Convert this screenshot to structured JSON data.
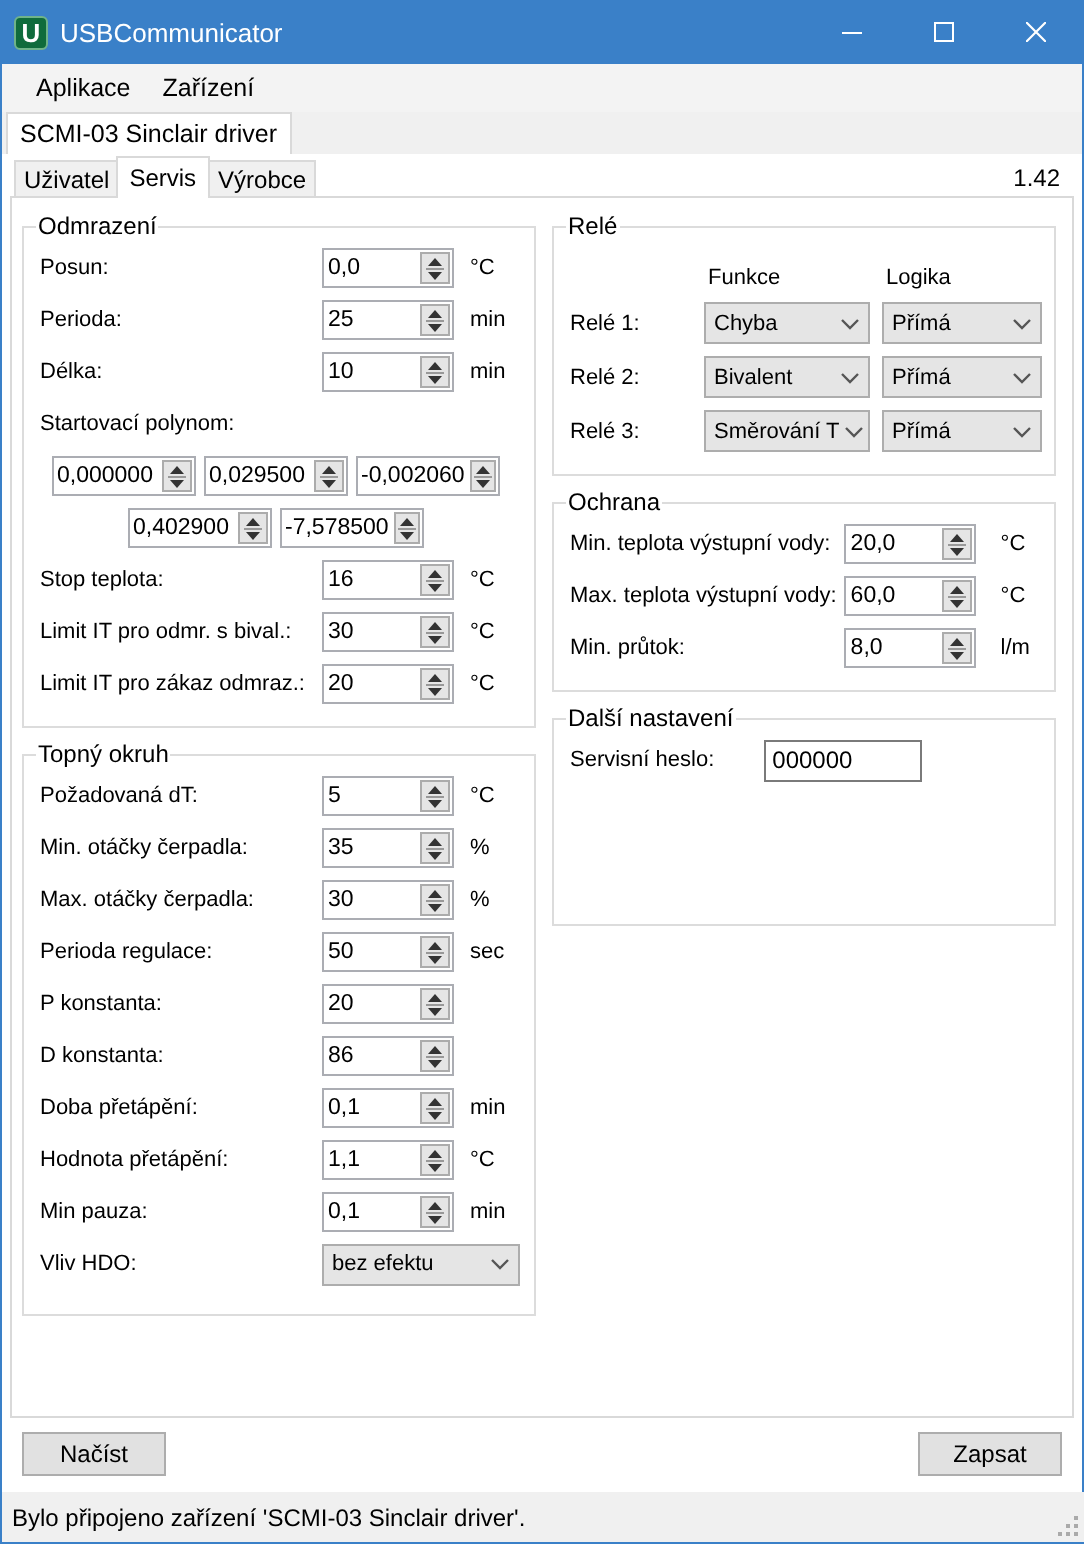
{
  "window": {
    "title": "USBCommunicator",
    "icon_letter": "U"
  },
  "menu": [
    "Aplikace",
    "Zařízení"
  ],
  "document_tabs": [
    {
      "label": "SCMI-03 Sinclair driver",
      "selected": true
    }
  ],
  "tabs": [
    {
      "label": "Uživatel",
      "selected": false
    },
    {
      "label": "Servis",
      "selected": true
    },
    {
      "label": "Výrobce",
      "selected": false
    }
  ],
  "version": "1.42",
  "left_groups": [
    {
      "title": "Odmrazení",
      "items": [
        {
          "kind": "spin",
          "label": "Posun:",
          "value": "0,0",
          "unit": "°C"
        },
        {
          "kind": "spin",
          "label": "Perioda:",
          "value": "25",
          "unit": "min"
        },
        {
          "kind": "spin",
          "label": "Délka:",
          "value": "10",
          "unit": "min"
        },
        {
          "kind": "heading",
          "label": "Startovací polynom:"
        },
        {
          "kind": "polynom",
          "values": [
            "0,000000",
            "0,029500",
            "-0,002060"
          ]
        },
        {
          "kind": "polynom",
          "values": [
            "0,402900",
            "-7,578500"
          ]
        },
        {
          "kind": "spin",
          "label": "Stop teplota:",
          "value": "16",
          "unit": "°C"
        },
        {
          "kind": "spin",
          "label": "Limit IT pro odmr. s bival.:",
          "value": "30",
          "unit": "°C"
        },
        {
          "kind": "spin",
          "label": "Limit IT pro zákaz odmraz.:",
          "value": "20",
          "unit": "°C"
        }
      ]
    },
    {
      "title": "Topný okruh",
      "items": [
        {
          "kind": "spin",
          "label": "Požadovaná dT:",
          "value": "5",
          "unit": "°C"
        },
        {
          "kind": "spin",
          "label": "Min. otáčky čerpadla:",
          "value": "35",
          "unit": "%"
        },
        {
          "kind": "spin",
          "label": "Max. otáčky čerpadla:",
          "value": "30",
          "unit": "%"
        },
        {
          "kind": "spin",
          "label": "Perioda regulace:",
          "value": "50",
          "unit": "sec"
        },
        {
          "kind": "spin",
          "label": "P konstanta:",
          "value": "20"
        },
        {
          "kind": "spin",
          "label": "D konstanta:",
          "value": "86"
        },
        {
          "kind": "spin",
          "label": "Doba přetápění:",
          "value": "0,1",
          "unit": "min"
        },
        {
          "kind": "spin",
          "label": "Hodnota přetápění:",
          "value": "1,1",
          "unit": "°C"
        },
        {
          "kind": "spin",
          "label": "Min pauza:",
          "value": "0,1",
          "unit": "min"
        },
        {
          "kind": "combo",
          "label": "Vliv HDO:",
          "value": "bez efektu"
        }
      ]
    }
  ],
  "relays": {
    "title": "Relé",
    "columns": [
      "Funkce",
      "Logika"
    ],
    "rows": [
      {
        "label": "Relé 1:",
        "function": "Chyba",
        "logic": "Přímá"
      },
      {
        "label": "Relé 2:",
        "function": "Bivalent",
        "logic": "Přímá"
      },
      {
        "label": "Relé 3:",
        "function": "Směrování T",
        "logic": "Přímá"
      }
    ]
  },
  "right_groups": [
    {
      "title": "Ochrana",
      "items": [
        {
          "kind": "spin",
          "label": "Min. teplota výstupní vody:",
          "value": "20,0",
          "unit": "°C"
        },
        {
          "kind": "spin",
          "label": "Max. teplota výstupní vody:",
          "value": "60,0",
          "unit": "°C"
        },
        {
          "kind": "spin",
          "label": "Min. průtok:",
          "value": "8,0",
          "unit": "l/m"
        }
      ]
    },
    {
      "title": "Další nastavení",
      "items": [
        {
          "kind": "text",
          "label": "Servisní heslo:",
          "value": "000000"
        }
      ]
    }
  ],
  "buttons": [
    "Načíst",
    "Zapsat"
  ],
  "status_bar": "Bylo připojeno zařízení 'SCMI-03 Sinclair driver'."
}
